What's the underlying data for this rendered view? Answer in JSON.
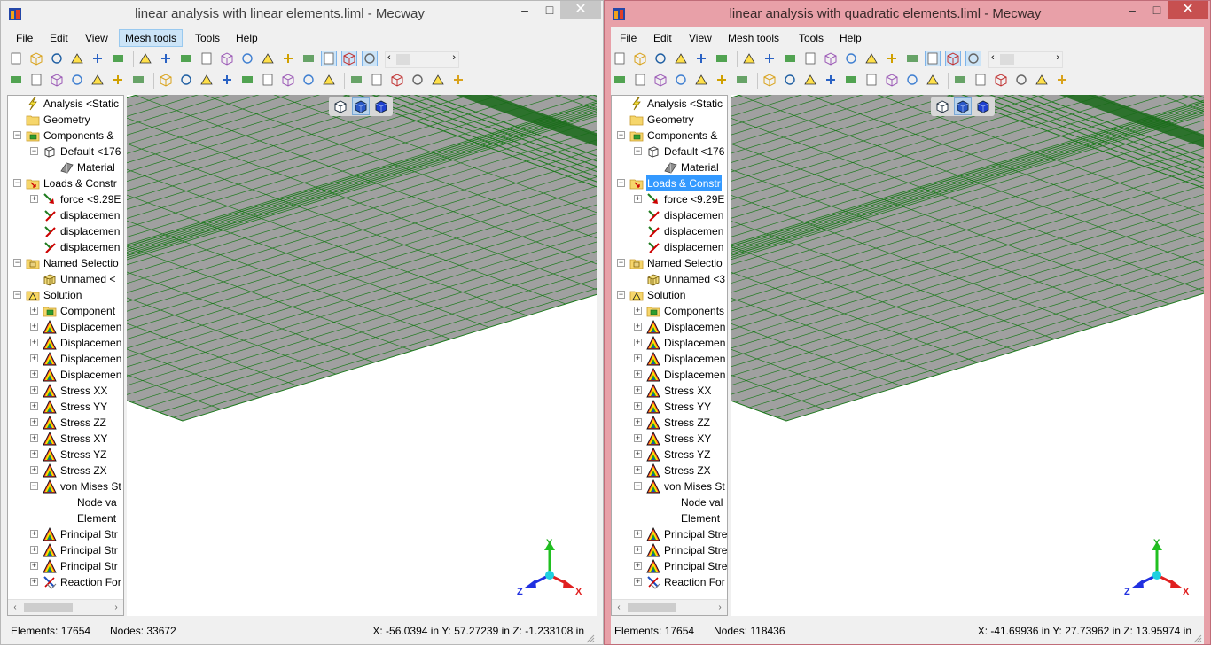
{
  "windows": [
    {
      "id": "left",
      "title": "linear analysis with linear elements.liml - Mecway",
      "active": false,
      "menu": [
        "File",
        "Edit",
        "View",
        "Mesh tools",
        "Tools",
        "Help"
      ],
      "active_menu": "Mesh tools",
      "tree": [
        {
          "label": "Analysis <Static",
          "icon": "analysis-lightning-icon",
          "indent": 0,
          "expander": "none"
        },
        {
          "label": "Geometry",
          "icon": "folder-icon",
          "indent": 0,
          "expander": "none"
        },
        {
          "label": "Components &",
          "icon": "components-icon",
          "indent": 0,
          "expander": "minus"
        },
        {
          "label": "Default <176",
          "icon": "component-part-icon",
          "indent": 1,
          "expander": "minus"
        },
        {
          "label": "Material",
          "icon": "material-icon",
          "indent": 2,
          "expander": "none"
        },
        {
          "label": "Loads & Constr",
          "icon": "loads-folder-icon",
          "indent": 0,
          "expander": "minus",
          "selected": false
        },
        {
          "label": "force <9.29E",
          "icon": "force-icon",
          "indent": 1,
          "expander": "plus"
        },
        {
          "label": "displacemen",
          "icon": "displacement-constraint-icon",
          "indent": 1,
          "expander": "none"
        },
        {
          "label": "displacemen",
          "icon": "displacement-constraint-icon",
          "indent": 1,
          "expander": "none"
        },
        {
          "label": "displacemen",
          "icon": "displacement-constraint-icon",
          "indent": 1,
          "expander": "none"
        },
        {
          "label": "Named Selectio",
          "icon": "named-selection-folder-icon",
          "indent": 0,
          "expander": "minus"
        },
        {
          "label": "Unnamed <",
          "icon": "selection-cube-icon",
          "indent": 1,
          "expander": "none"
        },
        {
          "label": "Solution",
          "icon": "solution-triangle-icon",
          "indent": 0,
          "expander": "minus"
        },
        {
          "label": "Component",
          "icon": "components-icon",
          "indent": 1,
          "expander": "plus"
        },
        {
          "label": "Displacemen",
          "icon": "result-triangle-icon",
          "indent": 1,
          "expander": "plus"
        },
        {
          "label": "Displacemen",
          "icon": "result-triangle-icon",
          "indent": 1,
          "expander": "plus"
        },
        {
          "label": "Displacemen",
          "icon": "result-triangle-icon",
          "indent": 1,
          "expander": "plus"
        },
        {
          "label": "Displacemen",
          "icon": "result-triangle-icon",
          "indent": 1,
          "expander": "plus"
        },
        {
          "label": "Stress XX",
          "icon": "result-triangle-icon",
          "indent": 1,
          "expander": "plus"
        },
        {
          "label": "Stress YY",
          "icon": "result-triangle-icon",
          "indent": 1,
          "expander": "plus"
        },
        {
          "label": "Stress ZZ",
          "icon": "result-triangle-icon",
          "indent": 1,
          "expander": "plus"
        },
        {
          "label": "Stress XY",
          "icon": "result-triangle-icon",
          "indent": 1,
          "expander": "plus"
        },
        {
          "label": "Stress YZ",
          "icon": "result-triangle-icon",
          "indent": 1,
          "expander": "plus"
        },
        {
          "label": "Stress ZX",
          "icon": "result-triangle-icon",
          "indent": 1,
          "expander": "plus"
        },
        {
          "label": "von Mises St",
          "icon": "result-triangle-icon",
          "indent": 1,
          "expander": "minus"
        },
        {
          "label": "Node va",
          "icon": "none",
          "indent": 2,
          "expander": "none"
        },
        {
          "label": "Element",
          "icon": "none",
          "indent": 2,
          "expander": "none"
        },
        {
          "label": "Principal Str",
          "icon": "result-triangle-icon",
          "indent": 1,
          "expander": "plus"
        },
        {
          "label": "Principal Str",
          "icon": "result-triangle-icon",
          "indent": 1,
          "expander": "plus"
        },
        {
          "label": "Principal Str",
          "icon": "result-triangle-icon",
          "indent": 1,
          "expander": "plus"
        },
        {
          "label": "Reaction For",
          "icon": "reaction-force-icon",
          "indent": 1,
          "expander": "plus"
        }
      ],
      "status": {
        "elements": "Elements:  17654",
        "nodes": "Nodes: 33672",
        "coords": "X: -56.0394 in Y: 57.27239 in Z: -1.233108 in"
      }
    },
    {
      "id": "right",
      "title": "linear analysis with quadratic elements.liml - Mecway",
      "active": true,
      "menu": [
        "File",
        "Edit",
        "View",
        "Mesh tools",
        "Tools",
        "Help"
      ],
      "active_menu": "",
      "tree": [
        {
          "label": "Analysis <Static",
          "icon": "analysis-lightning-icon",
          "indent": 0,
          "expander": "none"
        },
        {
          "label": "Geometry",
          "icon": "folder-icon",
          "indent": 0,
          "expander": "none"
        },
        {
          "label": "Components &",
          "icon": "components-icon",
          "indent": 0,
          "expander": "minus"
        },
        {
          "label": "Default <176",
          "icon": "component-part-icon",
          "indent": 1,
          "expander": "minus"
        },
        {
          "label": "Material",
          "icon": "material-icon",
          "indent": 2,
          "expander": "none"
        },
        {
          "label": "Loads & Constr",
          "icon": "loads-folder-icon",
          "indent": 0,
          "expander": "minus",
          "selected": true
        },
        {
          "label": "force <9.29E",
          "icon": "force-icon",
          "indent": 1,
          "expander": "plus"
        },
        {
          "label": "displacemen",
          "icon": "displacement-constraint-icon",
          "indent": 1,
          "expander": "none"
        },
        {
          "label": "displacemen",
          "icon": "displacement-constraint-icon",
          "indent": 1,
          "expander": "none"
        },
        {
          "label": "displacemen",
          "icon": "displacement-constraint-icon",
          "indent": 1,
          "expander": "none"
        },
        {
          "label": "Named Selectio",
          "icon": "named-selection-folder-icon",
          "indent": 0,
          "expander": "minus"
        },
        {
          "label": "Unnamed <3",
          "icon": "selection-cube-icon",
          "indent": 1,
          "expander": "none"
        },
        {
          "label": "Solution",
          "icon": "solution-triangle-icon",
          "indent": 0,
          "expander": "minus"
        },
        {
          "label": "Components",
          "icon": "components-icon",
          "indent": 1,
          "expander": "plus"
        },
        {
          "label": "Displacemen",
          "icon": "result-triangle-icon",
          "indent": 1,
          "expander": "plus"
        },
        {
          "label": "Displacemen",
          "icon": "result-triangle-icon",
          "indent": 1,
          "expander": "plus"
        },
        {
          "label": "Displacemen",
          "icon": "result-triangle-icon",
          "indent": 1,
          "expander": "plus"
        },
        {
          "label": "Displacemen",
          "icon": "result-triangle-icon",
          "indent": 1,
          "expander": "plus"
        },
        {
          "label": "Stress XX",
          "icon": "result-triangle-icon",
          "indent": 1,
          "expander": "plus"
        },
        {
          "label": "Stress YY",
          "icon": "result-triangle-icon",
          "indent": 1,
          "expander": "plus"
        },
        {
          "label": "Stress ZZ",
          "icon": "result-triangle-icon",
          "indent": 1,
          "expander": "plus"
        },
        {
          "label": "Stress XY",
          "icon": "result-triangle-icon",
          "indent": 1,
          "expander": "plus"
        },
        {
          "label": "Stress YZ",
          "icon": "result-triangle-icon",
          "indent": 1,
          "expander": "plus"
        },
        {
          "label": "Stress ZX",
          "icon": "result-triangle-icon",
          "indent": 1,
          "expander": "plus"
        },
        {
          "label": "von Mises St",
          "icon": "result-triangle-icon",
          "indent": 1,
          "expander": "minus"
        },
        {
          "label": "Node val",
          "icon": "none",
          "indent": 2,
          "expander": "none"
        },
        {
          "label": "Element",
          "icon": "none",
          "indent": 2,
          "expander": "none"
        },
        {
          "label": "Principal Stre",
          "icon": "result-triangle-icon",
          "indent": 1,
          "expander": "plus"
        },
        {
          "label": "Principal Stre",
          "icon": "result-triangle-icon",
          "indent": 1,
          "expander": "plus"
        },
        {
          "label": "Principal Stre",
          "icon": "result-triangle-icon",
          "indent": 1,
          "expander": "plus"
        },
        {
          "label": "Reaction For",
          "icon": "reaction-force-icon",
          "indent": 1,
          "expander": "plus"
        }
      ],
      "status": {
        "elements": "Elements:  17654",
        "nodes": "Nodes: 118436",
        "coords": "X: -41.69936 in Y: 27.73962 in Z: 13.95974 in"
      }
    }
  ],
  "triad": {
    "x": "X",
    "y": "Y",
    "z": "Z"
  },
  "window_buttons": {
    "minimize": "–",
    "maximize": "□",
    "close": "✕"
  },
  "colors": {
    "mesh_line": "#1f7a1f",
    "mesh_fill": "#a0a0a0",
    "selection_blue": "#3399ff",
    "active_window_border": "#e8a0a8"
  }
}
